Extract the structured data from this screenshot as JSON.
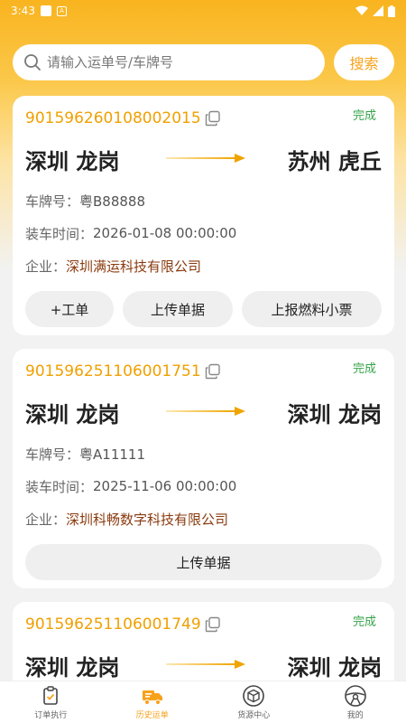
{
  "status_bar": {
    "time": "3:43"
  },
  "search": {
    "placeholder": "请输入运单号/车牌号",
    "button_label": "搜索"
  },
  "orders": [
    {
      "order_no": "901596260108002015",
      "status": "完成",
      "from": "深圳 龙岗",
      "to": "苏州 虎丘",
      "plate_label": "车牌号：",
      "plate": "粤B88888",
      "load_time_label": "装车时间：",
      "load_time": "2026-01-08 00:00:00",
      "company_label": "企业：",
      "company": "深圳满运科技有限公司",
      "actions": [
        "+工单",
        "上传单据",
        "上报燃料小票"
      ]
    },
    {
      "order_no": "901596251106001751",
      "status": "完成",
      "from": "深圳 龙岗",
      "to": "深圳 龙岗",
      "plate_label": "车牌号：",
      "plate": "粤A11111",
      "load_time_label": "装车时间：",
      "load_time": "2025-11-06 00:00:00",
      "company_label": "企业：",
      "company": "深圳科畅数字科技有限公司",
      "actions": [
        "上传单据"
      ]
    },
    {
      "order_no": "901596251106001749",
      "status": "完成",
      "from": "深圳 龙岗",
      "to": "深圳 龙岗"
    }
  ],
  "tabs": [
    {
      "label": "订单执行",
      "icon": "clipboard-icon",
      "active": false
    },
    {
      "label": "历史运单",
      "icon": "truck-icon",
      "active": true
    },
    {
      "label": "货源中心",
      "icon": "box-icon",
      "active": false
    },
    {
      "label": "我的",
      "icon": "steering-wheel-icon",
      "active": false
    }
  ],
  "colors": {
    "accent": "#f7a21b",
    "order_no": "#f0a000",
    "status_done": "#37a34a",
    "company": "#8a3b0f"
  }
}
